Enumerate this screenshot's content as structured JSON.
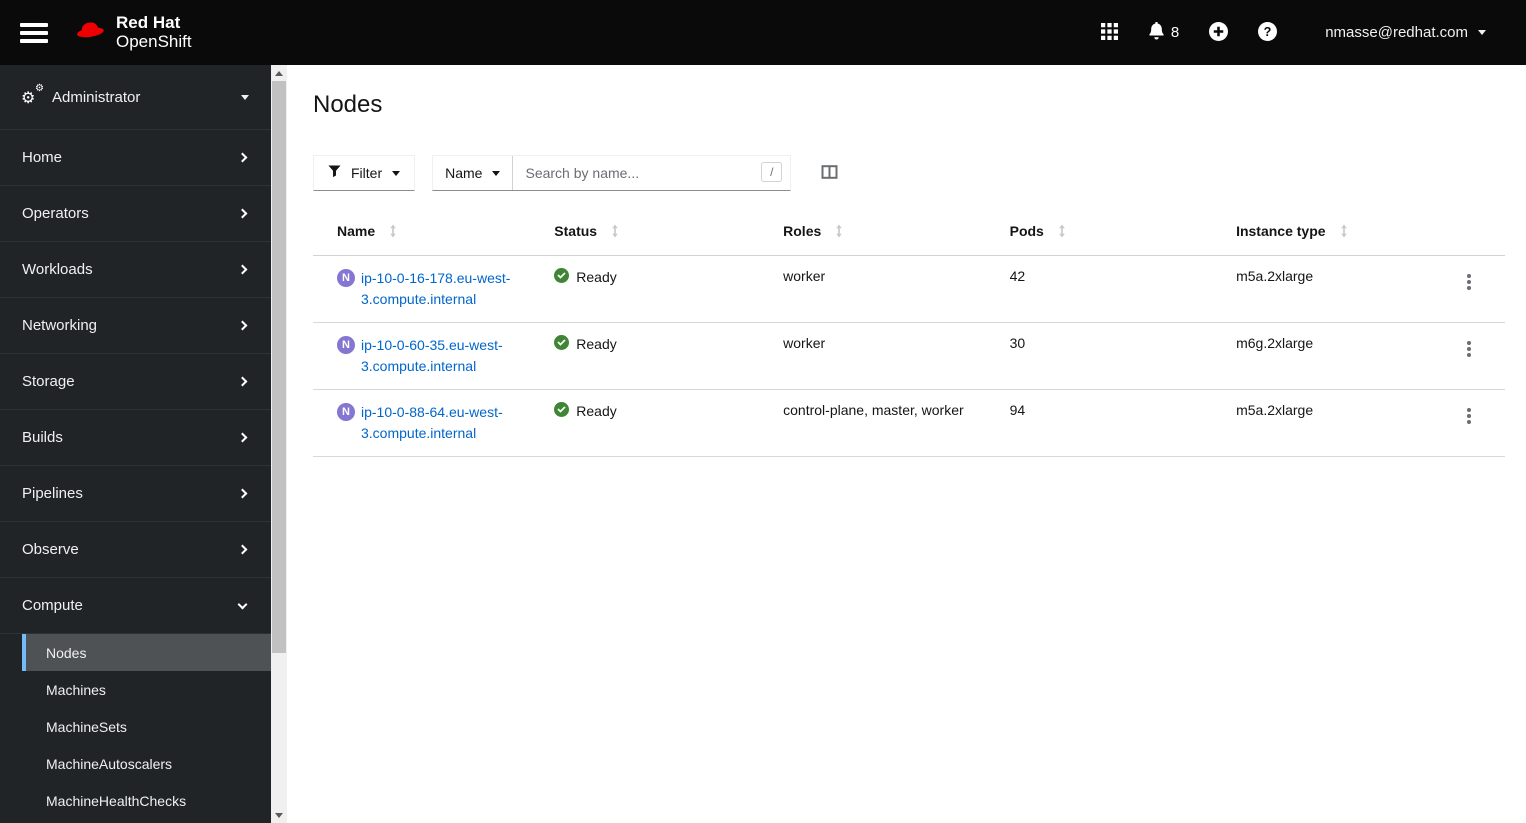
{
  "masthead": {
    "brand_line1": "Red Hat",
    "brand_line2": "OpenShift",
    "notification_count": "8",
    "user_email": "nmasse@redhat.com"
  },
  "sidebar": {
    "perspective": "Administrator",
    "nav": [
      {
        "label": "Home"
      },
      {
        "label": "Operators"
      },
      {
        "label": "Workloads"
      },
      {
        "label": "Networking"
      },
      {
        "label": "Storage"
      },
      {
        "label": "Builds"
      },
      {
        "label": "Pipelines"
      },
      {
        "label": "Observe"
      }
    ],
    "compute": {
      "label": "Compute",
      "active_item": "Nodes",
      "items": [
        {
          "label": "Nodes"
        },
        {
          "label": "Machines"
        },
        {
          "label": "MachineSets"
        },
        {
          "label": "MachineAutoscalers"
        },
        {
          "label": "MachineHealthChecks"
        }
      ]
    }
  },
  "main": {
    "title": "Nodes",
    "toolbar": {
      "filter_label": "Filter",
      "name_filter_label": "Name",
      "search_placeholder": "Search by name...",
      "shortcut_hint": "/"
    },
    "table": {
      "columns": [
        "Name",
        "Status",
        "Roles",
        "Pods",
        "Instance type"
      ],
      "rows": [
        {
          "badge": "N",
          "name": "ip-10-0-16-178.eu-west-3.compute.internal",
          "status": "Ready",
          "roles": "worker",
          "pods": "42",
          "instance_type": "m5a.2xlarge"
        },
        {
          "badge": "N",
          "name": "ip-10-0-60-35.eu-west-3.compute.internal",
          "status": "Ready",
          "roles": "worker",
          "pods": "30",
          "instance_type": "m6g.2xlarge"
        },
        {
          "badge": "N",
          "name": "ip-10-0-88-64.eu-west-3.compute.internal",
          "status": "Ready",
          "roles": "control-plane, master, worker",
          "pods": "94",
          "instance_type": "m5a.2xlarge"
        }
      ]
    }
  },
  "colors": {
    "accent_blue": "#73bcf7",
    "link_blue": "#0066cc",
    "success_green": "#3e8635",
    "node_badge_purple": "#8476d1"
  }
}
